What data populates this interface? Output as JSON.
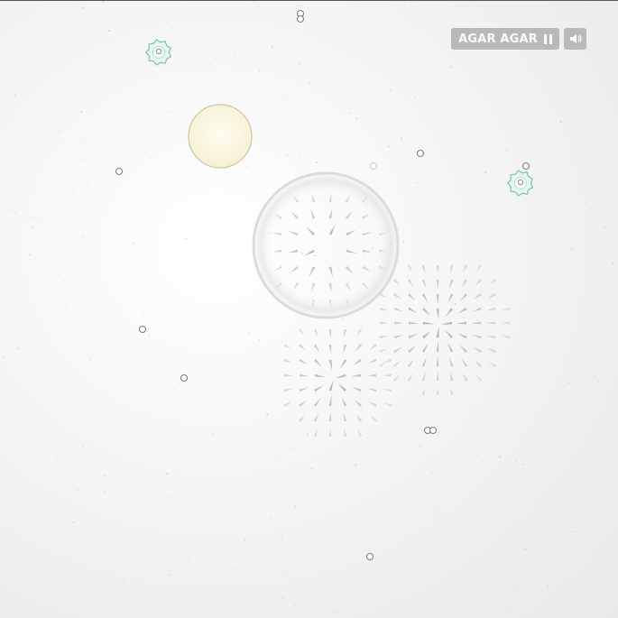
{
  "game": {
    "title": "AGAR AGAR",
    "controls": {
      "pause_icon": "pause-icon",
      "sound_icon": "speaker-icon"
    }
  },
  "colors": {
    "background": "#f4f4f4",
    "hud": "#b9b9b9",
    "hud_text": "#fafafa",
    "player_fill": "#fbf6e1",
    "player_stroke": "#c9c2a6",
    "germ_fill": "#e8f6f2",
    "germ_stroke": "#7fbfae",
    "particle_stroke": "#7d7d7d",
    "field_arrow": "#9a9a9a"
  }
}
